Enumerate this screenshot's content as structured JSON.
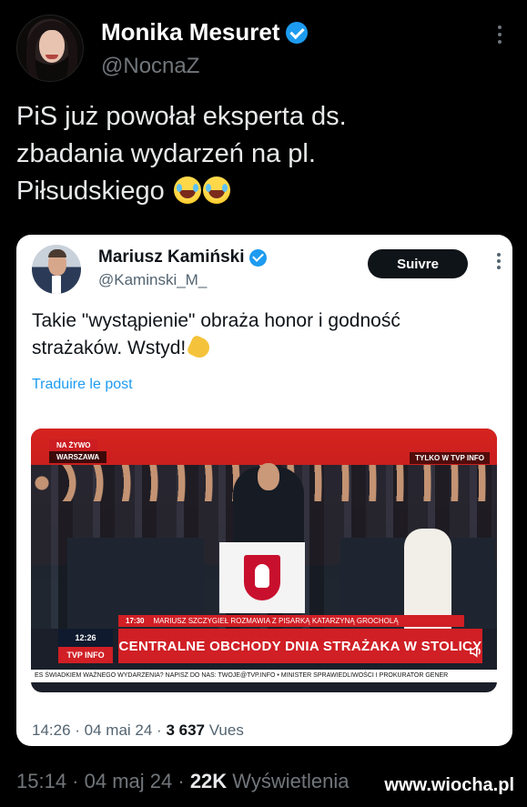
{
  "outer_tweet": {
    "author_name": "Monika Mesuret",
    "handle": "@NocnaZ",
    "text_line1": "PiS już powołał eksperta ds.",
    "text_line2": "zbadania wydarzeń na pl.",
    "text_line3": "Piłsudskiego",
    "emojis": [
      "face-with-tears-of-joy",
      "face-with-tears-of-joy"
    ],
    "time": "15:14",
    "date": "04 maj 24",
    "views": "22K",
    "views_label": "Wyświetlenia"
  },
  "quoted_tweet": {
    "author_name": "Mariusz Kamiński",
    "handle": "@Kaminski_M_",
    "follow_label": "Suivre",
    "text_line1": "Takie \"wystąpienie\" obraża honor i godność",
    "text_line2": "strażaków. Wstyd!",
    "emoji": "backhand-index-pointing-down",
    "translate_label": "Traduire le post",
    "time": "14:26",
    "date": "04 mai 24",
    "views": "3 637",
    "views_label": "Vues"
  },
  "video": {
    "live_tag": "NA ŻYWO",
    "place_tag": "WARSZAWA",
    "only_tag": "TYLKO W TVP INFO",
    "sub_time": "17:30",
    "sub_text": "MARIUSZ SZCZYGIEŁ ROZMAWIA Z PISARKĄ KATARZYNĄ GROCHOLĄ",
    "headline": "CENTRALNE OBCHODY DNIA STRAŻAKA W STOLICY",
    "clock": "12:26",
    "channel": "TVP INFO",
    "ticker": "ES ŚWIADKIEM WAŻNEGO WYDARZENIA? NAPISZ DO NAS: TWOJE@TVP.INFO • MINISTER SPRAWIEDLIWOŚCI I PROKURATOR GENER"
  },
  "watermark": "www.wiocha.pl",
  "colors": {
    "background": "#000000",
    "accent": "#1d9bf0",
    "tvp_red": "#d01f25"
  }
}
